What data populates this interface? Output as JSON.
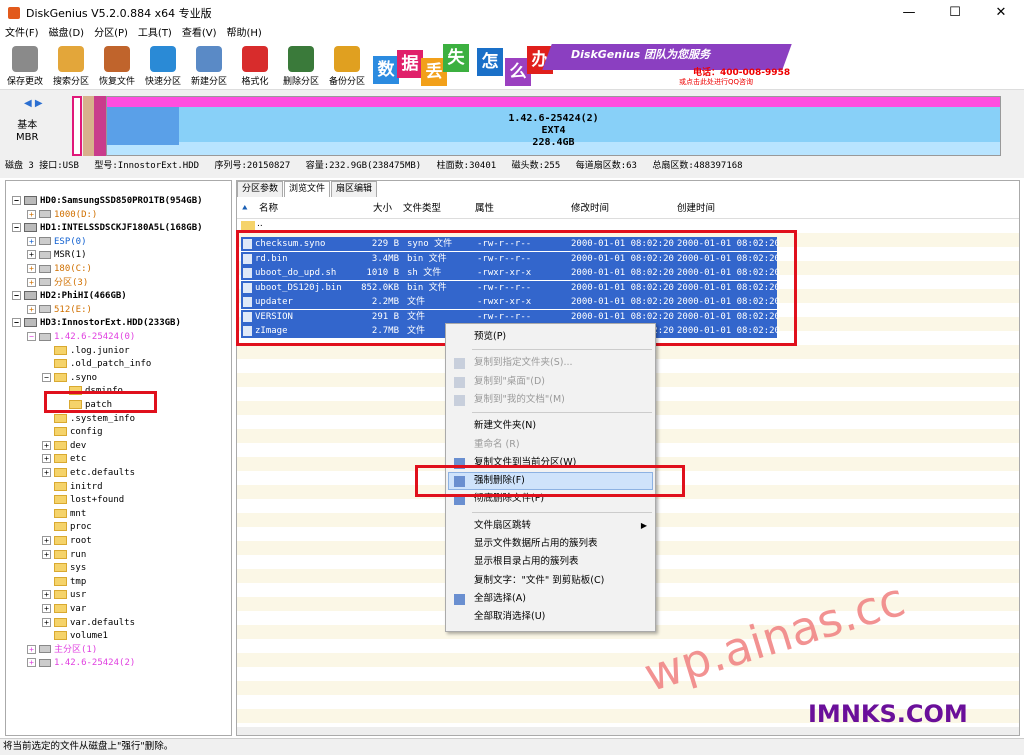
{
  "window": {
    "title": "DiskGenius V5.2.0.884 x64 专业版",
    "min": "—",
    "max": "☐",
    "close": "✕"
  },
  "menu": [
    "文件(F)",
    "磁盘(D)",
    "分区(P)",
    "工具(T)",
    "查看(V)",
    "帮助(H)"
  ],
  "toolbar": [
    {
      "label": "保存更改",
      "icon": "save-icon",
      "color": "#8a8a8a"
    },
    {
      "label": "搜索分区",
      "icon": "search-icon",
      "color": "#e3a63a"
    },
    {
      "label": "恢复文件",
      "icon": "recover-file-icon",
      "color": "#c0642c"
    },
    {
      "label": "快速分区",
      "icon": "quick-partition-icon",
      "color": "#2a8ad6"
    },
    {
      "label": "新建分区",
      "icon": "new-partition-icon",
      "color": "#5a8ac6"
    },
    {
      "label": "格式化",
      "icon": "format-icon",
      "color": "#d82c2c"
    },
    {
      "label": "删除分区",
      "icon": "delete-partition-icon",
      "color": "#3a7a3a"
    },
    {
      "label": "备份分区",
      "icon": "backup-partition-icon",
      "color": "#e0a020"
    }
  ],
  "banner": {
    "chars": [
      "数",
      "据",
      "丢",
      "失",
      "怎",
      "么",
      "办"
    ],
    "brand": "DiskGenius 团队为您服务",
    "phone": "电话：400-008-9958",
    "qq": "或点击此处进行QQ咨询",
    "char_colors": [
      "#2b8be0",
      "#e0206a",
      "#f2a01a",
      "#3cb040",
      "#1a70c8",
      "#9b40c0",
      "#e0201c"
    ]
  },
  "diskmap": {
    "nav": "◀ ▶",
    "label1": "基本",
    "label2": "MBR",
    "part_line1": "1.42.6-25424(2)",
    "part_line2": "EXT4",
    "part_line3": "228.4GB"
  },
  "diskinfo": [
    "磁盘 3 接口:USB",
    "型号:InnostorExt.HDD",
    "序列号:20150827",
    "容量:232.9GB(238475MB)",
    "柱面数:30401",
    "磁头数:255",
    "每道扇区数:63",
    "总扇区数:488397168"
  ],
  "tree": [
    {
      "text": "HD0:SamsungSSD850PRO1TB(954GB)",
      "kind": "disk",
      "indent": 0,
      "ex": "−",
      "cls": "bold"
    },
    {
      "text": "1000(D:)",
      "kind": "part",
      "indent": 1,
      "ex": "+",
      "cls": "c-orange"
    },
    {
      "text": "HD1:INTELSSDSCKJF180A5L(168GB)",
      "kind": "disk",
      "indent": 0,
      "ex": "−",
      "cls": "bold"
    },
    {
      "text": "ESP(0)",
      "kind": "part",
      "indent": 1,
      "ex": "+",
      "cls": "c-blue"
    },
    {
      "text": "MSR(1)",
      "kind": "part",
      "indent": 1,
      "ex": "+",
      "cls": ""
    },
    {
      "text": "180(C:)",
      "kind": "part",
      "indent": 1,
      "ex": "+",
      "cls": "c-orange"
    },
    {
      "text": "分区(3)",
      "kind": "part",
      "indent": 1,
      "ex": "+",
      "cls": "c-orange"
    },
    {
      "text": "HD2:PhiHI(466GB)",
      "kind": "disk",
      "indent": 0,
      "ex": "−",
      "cls": "bold"
    },
    {
      "text": "512(E:)",
      "kind": "part",
      "indent": 1,
      "ex": "+",
      "cls": "c-orange"
    },
    {
      "text": "HD3:InnostorExt.HDD(233GB)",
      "kind": "disk",
      "indent": 0,
      "ex": "−",
      "cls": "bold"
    },
    {
      "text": "1.42.6-25424(0)",
      "kind": "part",
      "indent": 1,
      "ex": "−",
      "cls": "c-pink"
    },
    {
      "text": ".log.junior",
      "kind": "folder",
      "indent": 2,
      "ex": "",
      "cls": ""
    },
    {
      "text": ".old_patch_info",
      "kind": "folder",
      "indent": 2,
      "ex": "",
      "cls": ""
    },
    {
      "text": ".syno",
      "kind": "folder",
      "indent": 2,
      "ex": "−",
      "cls": ""
    },
    {
      "text": "dsminfo",
      "kind": "folder",
      "indent": 3,
      "ex": "",
      "cls": ""
    },
    {
      "text": "patch",
      "kind": "folder",
      "indent": 3,
      "ex": "",
      "cls": ""
    },
    {
      "text": ".system_info",
      "kind": "folder",
      "indent": 2,
      "ex": "",
      "cls": ""
    },
    {
      "text": "config",
      "kind": "folder",
      "indent": 2,
      "ex": "",
      "cls": ""
    },
    {
      "text": "dev",
      "kind": "folder",
      "indent": 2,
      "ex": "+",
      "cls": ""
    },
    {
      "text": "etc",
      "kind": "folder",
      "indent": 2,
      "ex": "+",
      "cls": ""
    },
    {
      "text": "etc.defaults",
      "kind": "folder",
      "indent": 2,
      "ex": "+",
      "cls": ""
    },
    {
      "text": "initrd",
      "kind": "folder",
      "indent": 2,
      "ex": "",
      "cls": ""
    },
    {
      "text": "lost+found",
      "kind": "folder",
      "indent": 2,
      "ex": "",
      "cls": ""
    },
    {
      "text": "mnt",
      "kind": "folder",
      "indent": 2,
      "ex": "",
      "cls": ""
    },
    {
      "text": "proc",
      "kind": "folder",
      "indent": 2,
      "ex": "",
      "cls": ""
    },
    {
      "text": "root",
      "kind": "folder",
      "indent": 2,
      "ex": "+",
      "cls": ""
    },
    {
      "text": "run",
      "kind": "folder",
      "indent": 2,
      "ex": "+",
      "cls": ""
    },
    {
      "text": "sys",
      "kind": "folder",
      "indent": 2,
      "ex": "",
      "cls": ""
    },
    {
      "text": "tmp",
      "kind": "folder",
      "indent": 2,
      "ex": "",
      "cls": ""
    },
    {
      "text": "usr",
      "kind": "folder",
      "indent": 2,
      "ex": "+",
      "cls": ""
    },
    {
      "text": "var",
      "kind": "folder",
      "indent": 2,
      "ex": "+",
      "cls": ""
    },
    {
      "text": "var.defaults",
      "kind": "folder",
      "indent": 2,
      "ex": "+",
      "cls": ""
    },
    {
      "text": "volume1",
      "kind": "folder",
      "indent": 2,
      "ex": "",
      "cls": ""
    },
    {
      "text": "主分区(1)",
      "kind": "part",
      "indent": 1,
      "ex": "+",
      "cls": "c-pink"
    },
    {
      "text": "1.42.6-25424(2)",
      "kind": "part",
      "indent": 1,
      "ex": "+",
      "cls": "c-pink"
    }
  ],
  "tabs": [
    "分区参数",
    "浏览文件",
    "扇区编辑"
  ],
  "columns": {
    "name": "名称",
    "size": "大小",
    "type": "文件类型",
    "attr": "属性",
    "mtime": "修改时间",
    "ctime": "创建时间"
  },
  "updir": "..",
  "files": [
    {
      "name": "checksum.syno",
      "size": "229 B",
      "type": "syno 文件",
      "attr": "-rw-r--r--",
      "mtime": "2000-01-01 08:02:20",
      "ctime": "2000-01-01 08:02:20"
    },
    {
      "name": "rd.bin",
      "size": "3.4MB",
      "type": "bin 文件",
      "attr": "-rw-r--r--",
      "mtime": "2000-01-01 08:02:20",
      "ctime": "2000-01-01 08:02:20"
    },
    {
      "name": "uboot_do_upd.sh",
      "size": "1010 B",
      "type": "sh 文件",
      "attr": "-rwxr-xr-x",
      "mtime": "2000-01-01 08:02:20",
      "ctime": "2000-01-01 08:02:20"
    },
    {
      "name": "uboot_DS120j.bin",
      "size": "852.0KB",
      "type": "bin 文件",
      "attr": "-rw-r--r--",
      "mtime": "2000-01-01 08:02:20",
      "ctime": "2000-01-01 08:02:20"
    },
    {
      "name": "updater",
      "size": "2.2MB",
      "type": "文件",
      "attr": "-rwxr-xr-x",
      "mtime": "2000-01-01 08:02:20",
      "ctime": "2000-01-01 08:02:20"
    },
    {
      "name": "VERSION",
      "size": "291 B",
      "type": "文件",
      "attr": "-rw-r--r--",
      "mtime": "2000-01-01 08:02:20",
      "ctime": "2000-01-01 08:02:20"
    },
    {
      "name": "zImage",
      "size": "2.7MB",
      "type": "文件",
      "attr": "-rw-r--r--",
      "mtime": "2000-01-01 08:02:20",
      "ctime": "2000-01-01 08:02:20"
    }
  ],
  "context_menu": [
    {
      "label": "预览(P)",
      "disabled": false,
      "icon": ""
    },
    {
      "sep": true
    },
    {
      "label": "复制到指定文件夹(S)...",
      "disabled": true,
      "icon": "copy-to-folder-icon"
    },
    {
      "label": "复制到\"桌面\"(D)",
      "disabled": true,
      "icon": "copy-to-desktop-icon"
    },
    {
      "label": "复制到\"我的文档\"(M)",
      "disabled": true,
      "icon": "copy-to-documents-icon"
    },
    {
      "sep": true
    },
    {
      "label": "新建文件夹(N)",
      "disabled": false,
      "icon": ""
    },
    {
      "label": "重命名 (R)",
      "disabled": true,
      "icon": ""
    },
    {
      "label": "复制文件到当前分区(W)",
      "disabled": false,
      "icon": "copy-to-partition-icon"
    },
    {
      "label": "强制删除(F)",
      "disabled": false,
      "icon": "force-delete-icon",
      "highlight": true
    },
    {
      "label": "彻底删除文件(P)",
      "disabled": false,
      "icon": "wipe-delete-icon"
    },
    {
      "sep": true
    },
    {
      "label": "文件扇区跳转",
      "disabled": false,
      "icon": "",
      "submenu": true
    },
    {
      "label": "显示文件数据所占用的簇列表",
      "disabled": false,
      "icon": ""
    },
    {
      "label": "显示根目录占用的簇列表",
      "disabled": false,
      "icon": ""
    },
    {
      "label": "复制文字：\"文件\" 到剪贴板(C)",
      "disabled": false,
      "icon": ""
    },
    {
      "label": "全部选择(A)",
      "disabled": false,
      "icon": "select-all-icon"
    },
    {
      "label": "全部取消选择(U)",
      "disabled": false,
      "icon": ""
    }
  ],
  "status": "将当前选定的文件从磁盘上\"强行\"删除。",
  "watermarks": [
    "wp.ainas.cc",
    "IMNKS.COM"
  ]
}
